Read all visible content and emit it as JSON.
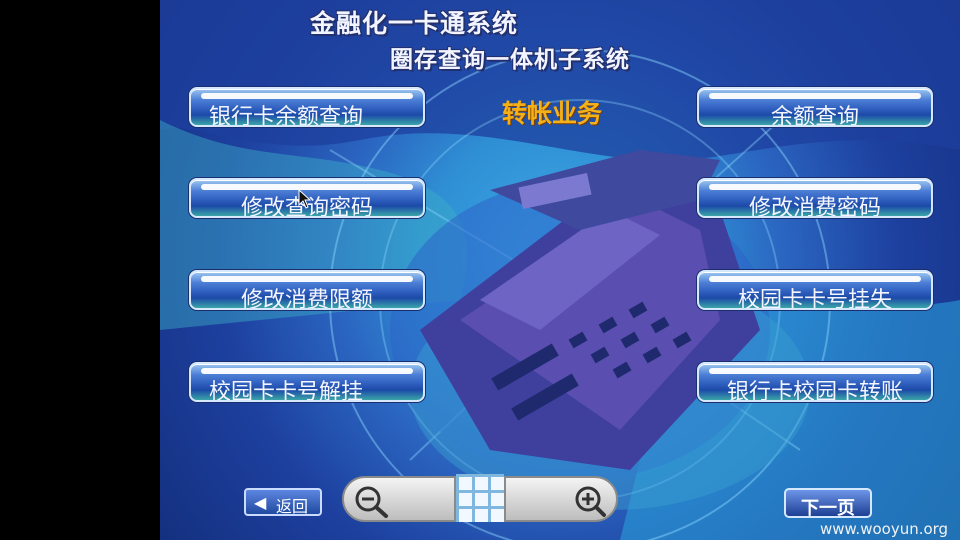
{
  "header": {
    "title": "金融化一卡通系统",
    "subtitle": "圈存查询一体机子系统",
    "section": "转帐业务"
  },
  "menu": {
    "left": [
      {
        "label": "银行卡余额查询"
      },
      {
        "label": "修改查询密码"
      },
      {
        "label": "修改消费限额"
      },
      {
        "label": "校园卡卡号解挂"
      }
    ],
    "right": [
      {
        "label": "余额查询"
      },
      {
        "label": "修改消费密码"
      },
      {
        "label": "校园卡卡号挂失"
      },
      {
        "label": "银行卡校园卡转账"
      }
    ]
  },
  "footer": {
    "back_label": "返回",
    "next_label": "下一页",
    "zoom_out_icon": "zoom-out-icon",
    "zoom_in_icon": "zoom-in-icon",
    "grid_icon": "grid-icon"
  },
  "watermark": "www.wooyun.org",
  "colors": {
    "background": "#2f8fd4",
    "section_title": "#f5b018",
    "button_text": "#f4f6ff"
  }
}
